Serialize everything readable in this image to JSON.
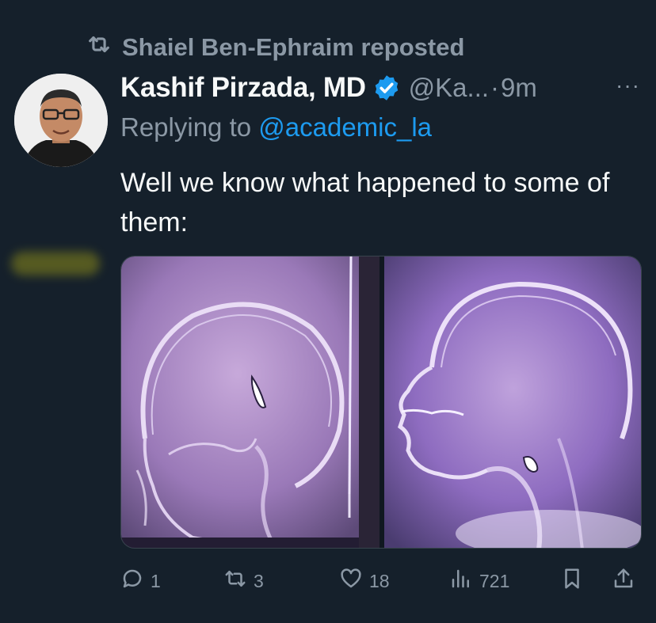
{
  "repost": {
    "text": "Shaiel Ben-Ephraim reposted"
  },
  "tweet": {
    "display_name": "Kashif Pirzada, MD",
    "handle": "@Ka...",
    "separator": "·",
    "time": "9m",
    "more": "···",
    "replying_prefix": "Replying to ",
    "replying_handle": "@academic_la",
    "text": "Well we know what happened to some of them:"
  },
  "actions": {
    "replies": "1",
    "reposts": "3",
    "likes": "18",
    "views": "721"
  },
  "colors": {
    "background": "#15202b",
    "muted": "#8b98a5",
    "accent": "#1d9bf0",
    "text": "#f7f9f9"
  }
}
